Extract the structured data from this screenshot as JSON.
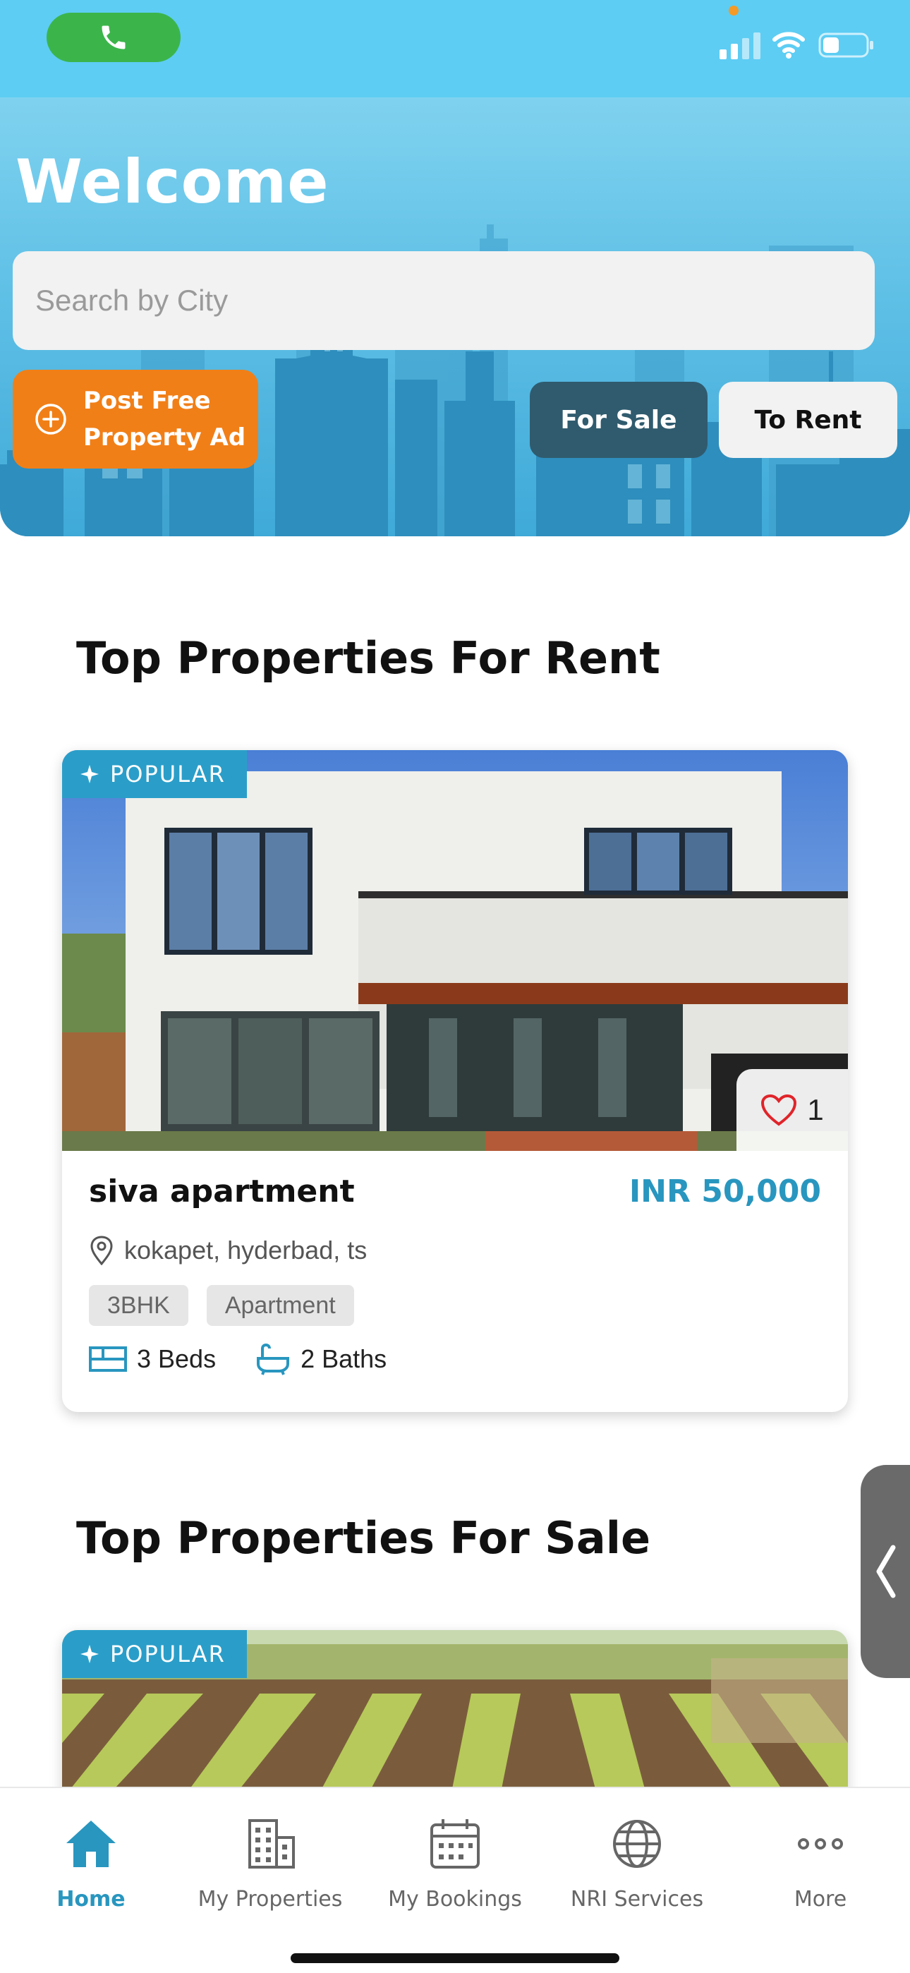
{
  "hero": {
    "title": "Welcome",
    "search_placeholder": "Search by City",
    "post_ad_label": "Post Free Property Ad",
    "for_sale_label": "For Sale",
    "to_rent_label": "To Rent"
  },
  "sections": [
    {
      "title": "Top Properties For Rent",
      "card": {
        "badge": "POPULAR",
        "likes": "1",
        "name": "siva apartment",
        "price": "INR 50,000",
        "location": "kokapet, hyderbad, ts",
        "tags": [
          "3BHK",
          "Apartment"
        ],
        "beds": "3 Beds",
        "baths": "2 Baths"
      }
    },
    {
      "title": "Top Properties For Sale",
      "card": {
        "badge": "POPULAR"
      }
    }
  ],
  "bottom_nav": [
    {
      "label": "Home",
      "icon": "home-icon",
      "active": true
    },
    {
      "label": "My Properties",
      "icon": "building-icon",
      "active": false
    },
    {
      "label": "My Bookings",
      "icon": "calendar-icon",
      "active": false
    },
    {
      "label": "NRI Services",
      "icon": "globe-icon",
      "active": false
    },
    {
      "label": "More",
      "icon": "more-dots-icon",
      "active": false
    }
  ],
  "colors": {
    "accent": "#2896bf",
    "post_button": "#f17f17",
    "for_sale_button": "#305b6e",
    "popular_badge": "#2a9ec9",
    "status_bar": "#5dcdf3"
  }
}
